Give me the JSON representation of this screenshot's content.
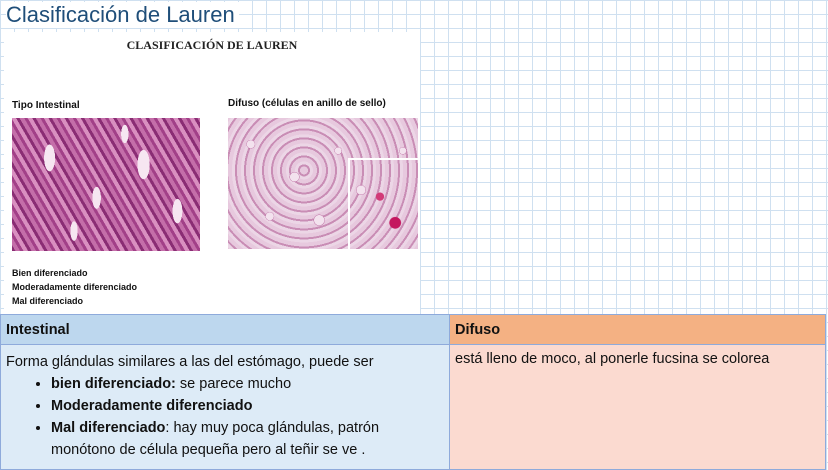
{
  "page_title": "Clasificación de Lauren",
  "figure": {
    "heading": "CLASIFICACIÓN DE LAUREN",
    "label_intestinal": "Tipo Intestinal",
    "label_difuso": "Difuso (células en anillo de sello)",
    "grades": [
      "Bien diferenciado",
      "Moderadamente diferenciado",
      "Mal diferenciado"
    ]
  },
  "table": {
    "header_intestinal": "Intestinal",
    "header_difuso": "Difuso",
    "intestinal_intro": "Forma glándulas similares a las del estómago, puede ser",
    "bullets": [
      {
        "bold": "bien diferenciado:",
        "text": " se parece mucho"
      },
      {
        "bold": "Moderadamente diferenciado",
        "text": ""
      },
      {
        "bold": "Mal diferenciado",
        "text": ": hay muy poca glándulas, patrón monótono de célula pequeña pero al teñir se ve ."
      }
    ],
    "difuso_text": "está lleno de moco, al ponerle fucsina se colorea"
  },
  "colors": {
    "title": "#1f4e79",
    "header_intestinal": "#bdd7ee",
    "header_difuso": "#f4b183",
    "cell_intestinal": "#ddebf7",
    "cell_difuso": "#fbdad0"
  }
}
